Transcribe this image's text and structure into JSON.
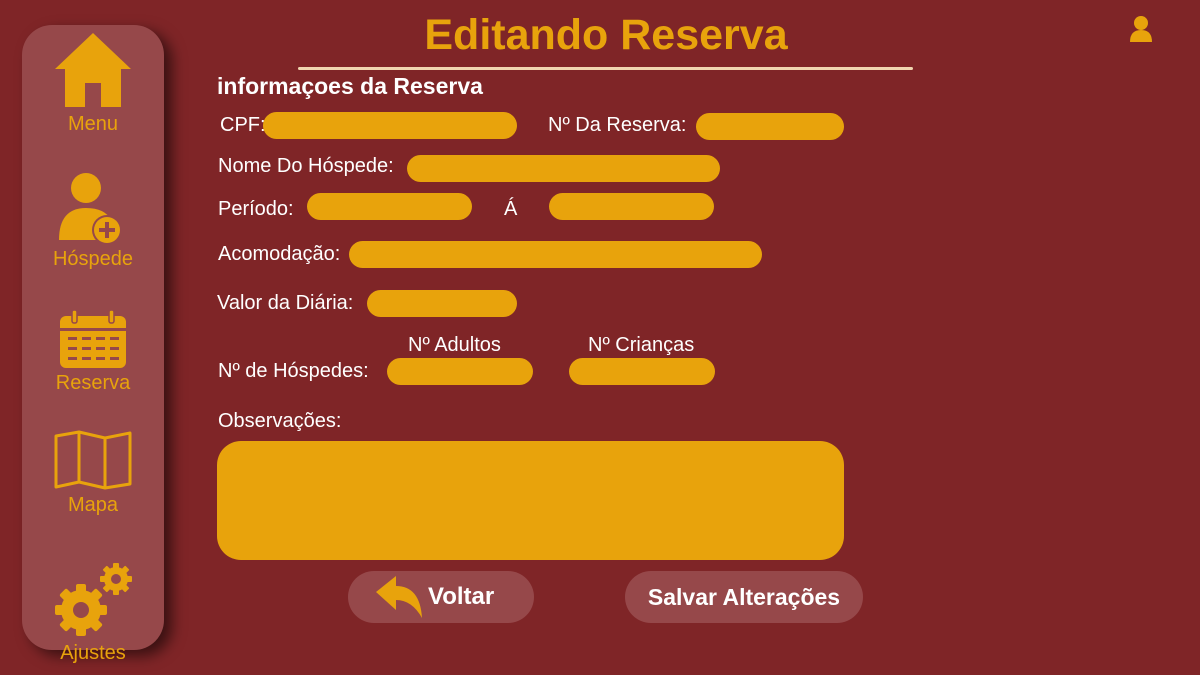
{
  "sidebar": {
    "items": [
      {
        "label": "Menu",
        "icon": "home-icon"
      },
      {
        "label": "Hóspede",
        "icon": "add-user-icon"
      },
      {
        "label": "Reserva",
        "icon": "calendar-icon"
      },
      {
        "label": "Mapa",
        "icon": "map-icon"
      },
      {
        "label": "Ajustes",
        "icon": "gears-icon"
      }
    ]
  },
  "header": {
    "title": "Editando Reserva",
    "user_icon": "user-icon"
  },
  "form": {
    "section_title": "informaçoes da Reserva",
    "cpf_label": "CPF:",
    "cpf_value": "",
    "reserva_label": "Nº Da Reserva:",
    "reserva_value": "",
    "nome_label": "Nome Do Hóspede:",
    "nome_value": "",
    "periodo_label": "Período:",
    "periodo_inicio": "",
    "periodo_sep": "Á",
    "periodo_fim": "",
    "acomodacao_label": "Acomodação:",
    "acomodacao_value": "",
    "diaria_label": "Valor da Diária:",
    "diaria_value": "",
    "hospedes_label": "Nº de Hóspedes:",
    "adultos_label": "Nº Adultos",
    "adultos_value": "",
    "criancas_label": "Nº Crianças",
    "criancas_value": "",
    "observacoes_label": "Observações:",
    "observacoes_value": ""
  },
  "actions": {
    "voltar_label": "Voltar",
    "salvar_label": "Salvar Alterações"
  },
  "colors": {
    "background": "#7f2527",
    "sidebar": "#96484a",
    "accent": "#e8a30c",
    "text": "#ffffff"
  }
}
